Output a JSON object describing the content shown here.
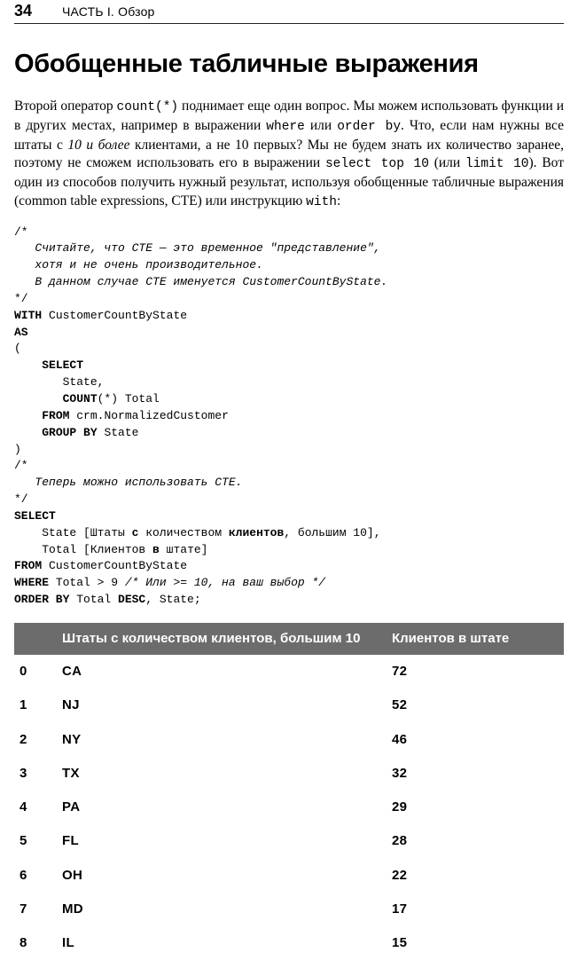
{
  "page_number": "34",
  "running_head": "ЧАСТЬ I. Обзор",
  "title": "Обобщенные табличные выражения",
  "para1_pre": "Второй оператор ",
  "code_count": "count(*)",
  "para1_mid": " поднимает еще один вопрос. Мы можем использовать функции и в других местах, например в выражении ",
  "code_where": "where",
  "para1_or": " или ",
  "code_orderby": "order by",
  "para1_post1": ". Что, если нам нужны все штаты с ",
  "italic_phrase": "10 и более",
  "para1_post2": " клиентами, а не 10 первых? Мы не будем знать их количество заранее, поэтому не сможем использовать его в выражении ",
  "code_selecttop": "select top 10",
  "para1_paren_open": " (или ",
  "code_limit": "limit 10",
  "para1_paren_close": "). Вот один из способов получить нужный результат, используя обобщенные табличные выражения (common table expressions, CTE) или инструкцию ",
  "code_with": "with",
  "para1_end": ":",
  "code_lines": [
    {
      "t": "/*",
      "b": 0,
      "i": 0
    },
    {
      "t": "   Считайте, что CTE — это временное \"представление\",",
      "b": 0,
      "i": 1
    },
    {
      "t": "   хотя и не очень производительное.",
      "b": 0,
      "i": 1
    },
    {
      "t": "   В данном случае CTE именуется CustomerCountByState.",
      "b": 0,
      "i": 1
    },
    {
      "t": "*/",
      "b": 0,
      "i": 0
    },
    {
      "pre": "WITH",
      "post": " CustomerCountByState"
    },
    {
      "pre": "AS",
      "post": ""
    },
    {
      "t": "(",
      "b": 0,
      "i": 0
    },
    {
      "pre": "    SELECT",
      "post": ""
    },
    {
      "t": "       State,",
      "b": 0,
      "i": 0
    },
    {
      "pre": "       COUNT",
      "post": "(*) Total"
    },
    {
      "pre": "    FROM",
      "post": " crm.NormalizedCustomer"
    },
    {
      "pre": "    GROUP BY",
      "post": " State"
    },
    {
      "t": ")",
      "b": 0,
      "i": 0
    },
    {
      "t": "/*",
      "b": 0,
      "i": 0
    },
    {
      "t": "   Теперь можно использовать CTE.",
      "b": 0,
      "i": 1
    },
    {
      "t": "*/",
      "b": 0,
      "i": 0
    },
    {
      "pre": "SELECT",
      "post": ""
    },
    {
      "seg": [
        "    State [Штаты ",
        {
          "b": "с"
        },
        " количеством ",
        {
          "b": "клиентов"
        },
        ", большим 10],"
      ]
    },
    {
      "seg": [
        "    Total [Клиентов ",
        {
          "b": "в"
        },
        " штате]"
      ]
    },
    {
      "pre": "FROM",
      "post": " CustomerCountByState"
    },
    {
      "seg": [
        {
          "b": "WHERE"
        },
        " Total > 9 ",
        {
          "i": "/* Или >= 10, на ваш выбор */"
        }
      ]
    },
    {
      "seg": [
        {
          "b": "ORDER BY"
        },
        " Total ",
        {
          "b": "DESC"
        },
        ", State;"
      ]
    }
  ],
  "chart_data": {
    "type": "table",
    "columns": [
      "",
      "Штаты с количеством клиентов, большим 10",
      "Клиентов в штате"
    ],
    "rows": [
      [
        "0",
        "CA",
        "72"
      ],
      [
        "1",
        "NJ",
        "52"
      ],
      [
        "2",
        "NY",
        "46"
      ],
      [
        "3",
        "TX",
        "32"
      ],
      [
        "4",
        "PA",
        "29"
      ],
      [
        "5",
        "FL",
        "28"
      ],
      [
        "6",
        "OH",
        "22"
      ],
      [
        "7",
        "MD",
        "17"
      ],
      [
        "8",
        "IL",
        "15"
      ]
    ]
  }
}
